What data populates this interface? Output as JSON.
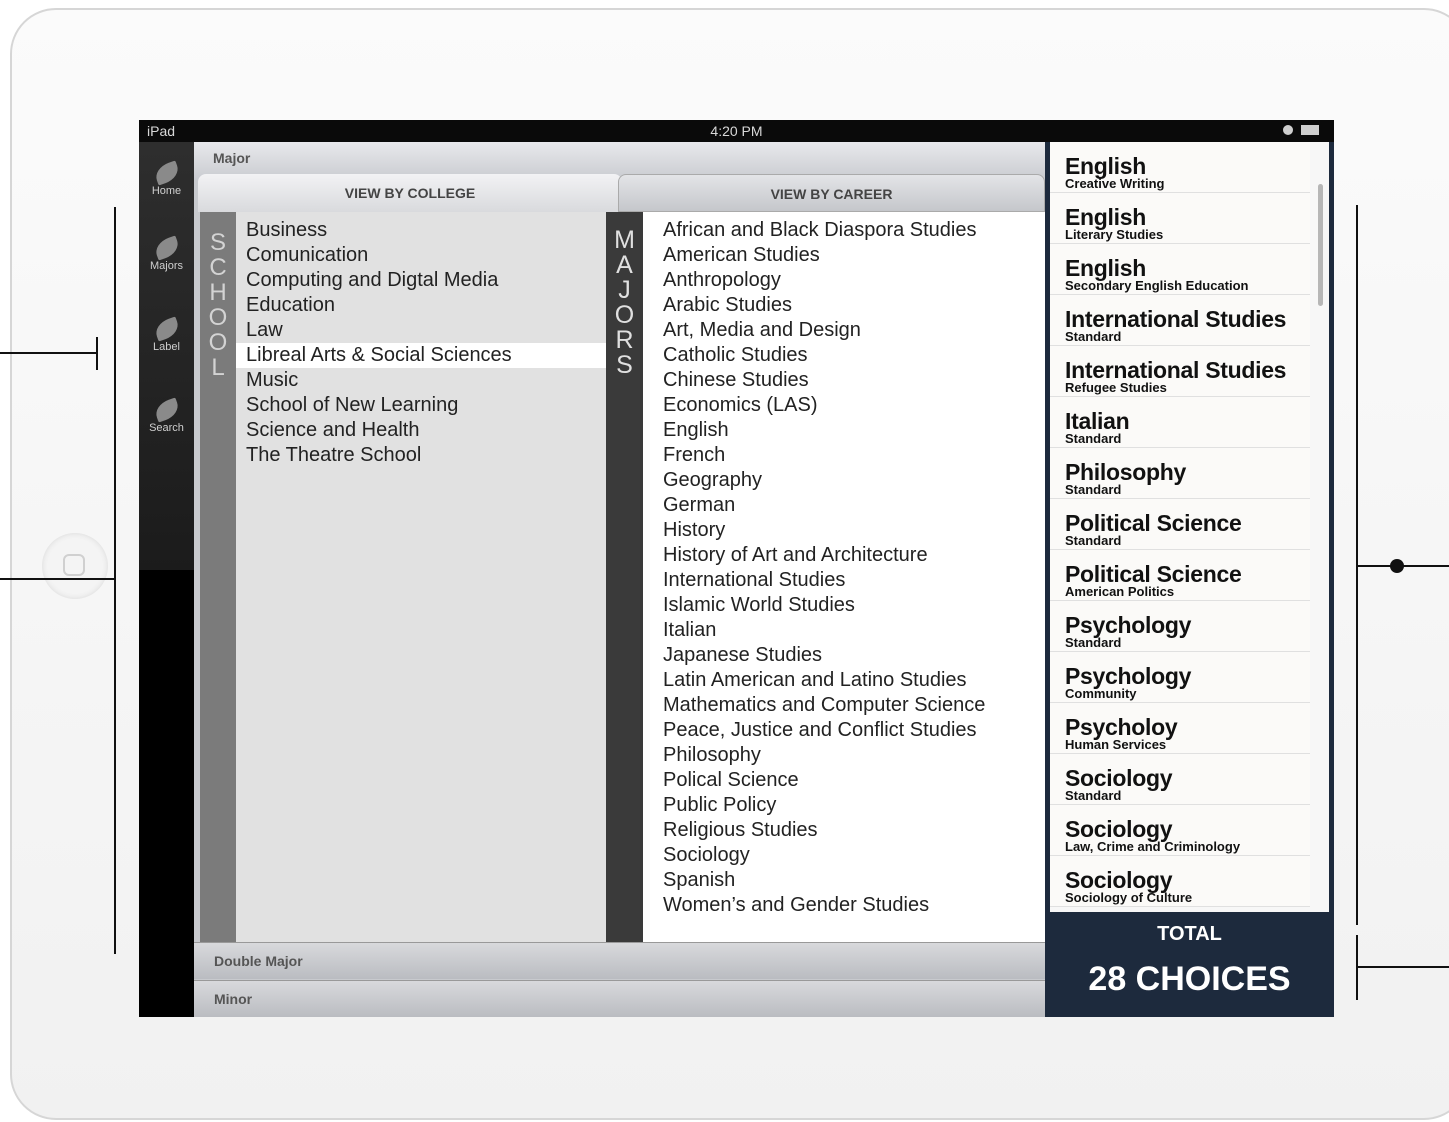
{
  "status_bar": {
    "carrier": "iPad",
    "time": "4:20 PM"
  },
  "sidebar": {
    "items": [
      {
        "label": "Home",
        "icon": "leaf-icon"
      },
      {
        "label": "Majors",
        "icon": "leaf-icon"
      },
      {
        "label": "Label",
        "icon": "leaf-icon"
      },
      {
        "label": "Search",
        "icon": "leaf-icon"
      }
    ]
  },
  "main": {
    "section_title": "Major",
    "tabs": [
      {
        "label": "VIEW BY COLLEGE"
      },
      {
        "label": "VIEW BY CAREER"
      }
    ],
    "school_letters": [
      "S",
      "C",
      "H",
      "O",
      "O",
      "L"
    ],
    "majors_letters": [
      "M",
      "A",
      "J",
      "O",
      "R",
      "S"
    ],
    "schools": [
      "Business",
      "Comunication",
      "Computing and Digtal Media",
      "Education",
      "Law",
      "Libreal Arts & Social Sciences",
      "Music",
      "School of New Learning",
      "Science and Health",
      "The Theatre School"
    ],
    "selected_school": "Libreal Arts & Social Sciences",
    "majors": [
      "African and Black Diaspora Studies",
      "American Studies",
      "Anthropology",
      "Arabic Studies",
      "Art, Media and Design",
      "Catholic Studies",
      "Chinese Studies",
      "Economics (LAS)",
      "English",
      "French",
      "Geography",
      "German",
      "History",
      "History of Art and Architecture",
      "International Studies",
      "Islamic World Studies",
      "Italian",
      "Japanese Studies",
      "Latin American and Latino Studies",
      "Mathematics and Computer Science",
      "Peace, Justice and Conflict Studies",
      "Philosophy",
      "Polical Science",
      "Public Policy",
      "Religious Studies",
      "Sociology",
      "Spanish",
      "Women’s and Gender Studies"
    ],
    "bottom_sections": [
      "Double Major",
      "Minor"
    ]
  },
  "choices": {
    "items": [
      {
        "title": "English",
        "sub": "Creative Writing"
      },
      {
        "title": "English",
        "sub": "Literary Studies"
      },
      {
        "title": "English",
        "sub": "Secondary English Education"
      },
      {
        "title": "International Studies",
        "sub": "Standard"
      },
      {
        "title": "International Studies",
        "sub": "Refugee Studies"
      },
      {
        "title": "Italian",
        "sub": "Standard"
      },
      {
        "title": "Philosophy",
        "sub": "Standard"
      },
      {
        "title": "Political Science",
        "sub": "Standard"
      },
      {
        "title": "Political Science",
        "sub": "American Politics"
      },
      {
        "title": "Psychology",
        "sub": "Standard"
      },
      {
        "title": "Psychology",
        "sub": "Community"
      },
      {
        "title": "Psycholoy",
        "sub": "Human Services"
      },
      {
        "title": "Sociology",
        "sub": "Standard"
      },
      {
        "title": "Sociology",
        "sub": "Law, Crime and Criminology"
      },
      {
        "title": "Sociology",
        "sub": "Sociology of Culture"
      }
    ],
    "total_label": "TOTAL",
    "total_count": "28 CHOICES"
  },
  "colors": {
    "panel_navy": "#1d2a3d",
    "school_bar": "#7b7b7b",
    "majors_bar": "#3a3a3a"
  }
}
